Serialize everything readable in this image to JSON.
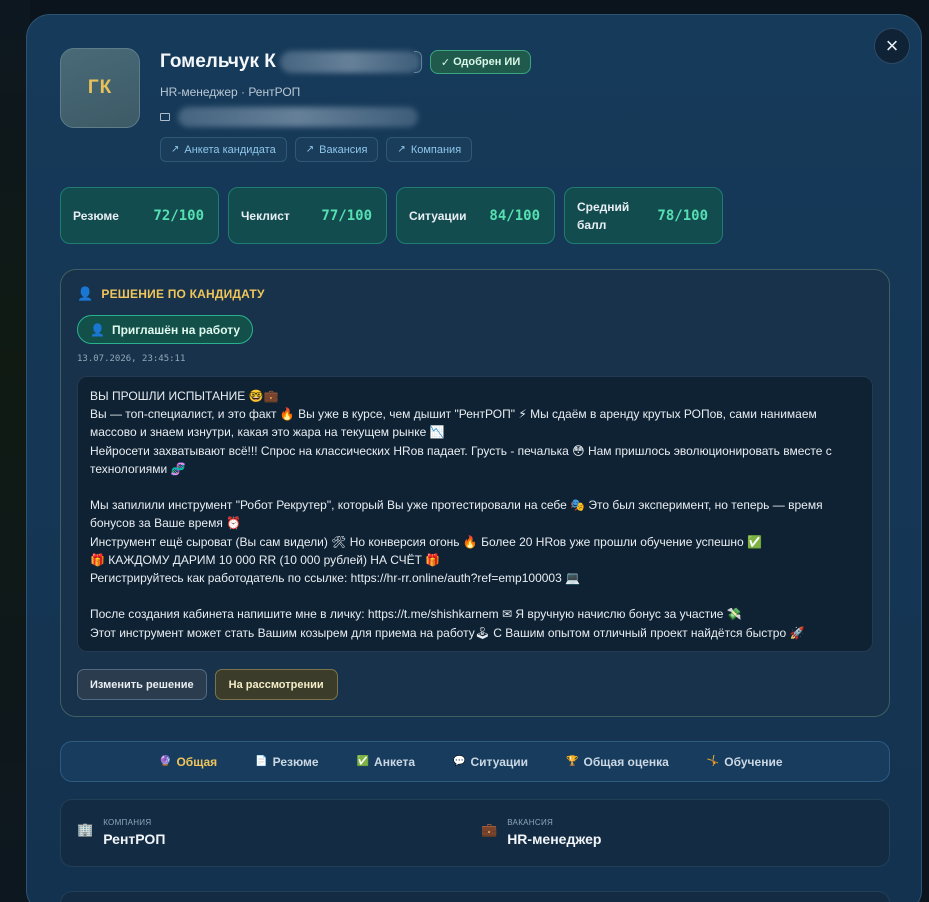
{
  "candidate": {
    "initials": "ГК",
    "name_visible": "Гомельчук К",
    "approved_badge": "Одобрен ИИ",
    "subtitle": "HR-менеджер · РентРОП",
    "links": [
      "Анкета кандидата",
      "Вакансия",
      "Компания"
    ]
  },
  "scores": [
    {
      "label": "Резюме",
      "value": "72/100"
    },
    {
      "label": "Чеклист",
      "value": "77/100"
    },
    {
      "label": "Ситуации",
      "value": "84/100"
    },
    {
      "label": "Средний балл",
      "value": "78/100"
    }
  ],
  "decision": {
    "title": "РЕШЕНИЕ ПО КАНДИДАТУ",
    "status": "Приглашён на работу",
    "date": "13.07.2026, 23:45:11",
    "message": [
      "ВЫ ПРОШЛИ ИСПЫТАНИЕ 🤓💼",
      "Вы — топ-специалист, и это факт 🔥 Вы уже в курсе, чем дышит \"РентРОП\" ⚡ Мы сдаём в аренду крутых РОПов, сами нанимаем массово и знаем изнутри, какая это жара на текущем рынке 📉",
      "Нейросети захватывают всё!!! Спрос на классических HRов падает. Грусть - печалька 😳 Нам пришлось эволюционировать вместе с технологиями 🧬",
      "",
      "Мы запилили инструмент \"Робот Рекрутер\", который Вы уже протестировали на себе 🎭 Это был эксперимент, но теперь — время бонусов за Ваше время ⏰",
      "Инструмент ещё сыроват (Вы сам видели) 🛠 Но конверсия огонь 🔥 Более 20 HRов уже прошли обучение успешно ✅",
      "🎁 КАЖДОМУ ДАРИМ 10 000 RR (10 000 рублей) НА СЧЁТ 🎁",
      "Регистрируйтесь как работодатель по ссылке: https://hr-rr.online/auth?ref=emp100003 💻",
      "",
      "После создания кабинета напишите мне в личку: https://t.me/shishkarnem ✉ Я вручную начислю бонус за участие 💸",
      "Этот инструмент может стать Вашим козырем для приема на работу🕹 С Вашим опытом отличный проект найдётся быстро 🚀"
    ],
    "buttons": {
      "change": "Изменить решение",
      "review": "На рассмотрении"
    }
  },
  "tabs": [
    {
      "label": "Общая",
      "icon": "🔮",
      "active": true
    },
    {
      "label": "Резюме",
      "icon": "📄",
      "active": false
    },
    {
      "label": "Анкета",
      "icon": "✅",
      "active": false
    },
    {
      "label": "Ситуации",
      "icon": "💬",
      "active": false
    },
    {
      "label": "Общая оценка",
      "icon": "🏆",
      "active": false
    },
    {
      "label": "Обучение",
      "icon": "🤸",
      "active": false
    }
  ],
  "info": {
    "company_label": "КОМПАНИЯ",
    "company_value": "РентРОП",
    "vacancy_label": "ВАКАНСИЯ",
    "vacancy_value": "HR-менеджер"
  },
  "colors": {
    "accent_gold": "#f0c55a",
    "score_green": "#56e0b2",
    "approved_green": "#3aa680"
  }
}
